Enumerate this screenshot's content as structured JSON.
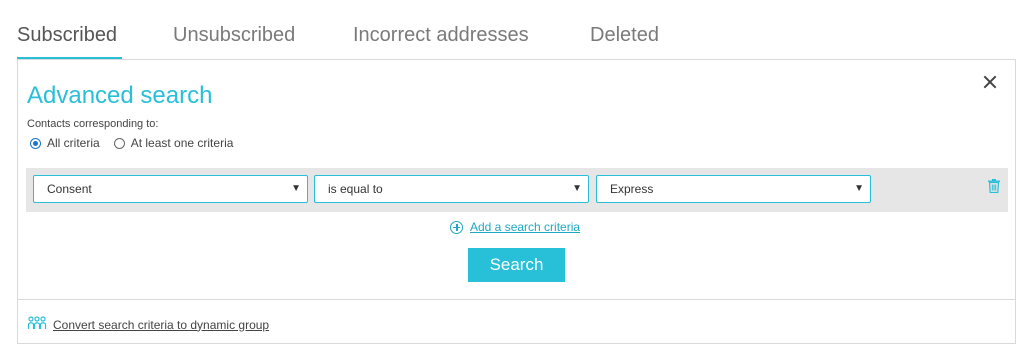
{
  "tabs": [
    {
      "label": "Subscribed",
      "active": true
    },
    {
      "label": "Unsubscribed",
      "active": false
    },
    {
      "label": "Incorrect addresses",
      "active": false
    },
    {
      "label": "Deleted",
      "active": false
    }
  ],
  "panel": {
    "title": "Advanced search",
    "contacts_label": "Contacts corresponding to:",
    "radios": [
      {
        "label": "All criteria",
        "checked": true
      },
      {
        "label": "At least one criteria",
        "checked": false
      }
    ],
    "criteria": {
      "field": "Consent",
      "operator": "is equal to",
      "value": "Express"
    },
    "add_criteria_label": "Add a search criteria",
    "search_button": "Search",
    "convert_link": "Convert search criteria to dynamic group"
  },
  "icons": {
    "close": "close-icon",
    "trash": "trash-icon",
    "add": "plus-circle-icon",
    "group": "group-icon",
    "caret": "caret-down-icon"
  },
  "colors": {
    "accent": "#28bfd8",
    "link": "#1ea8c4",
    "radio_checked": "#1a74c9"
  }
}
